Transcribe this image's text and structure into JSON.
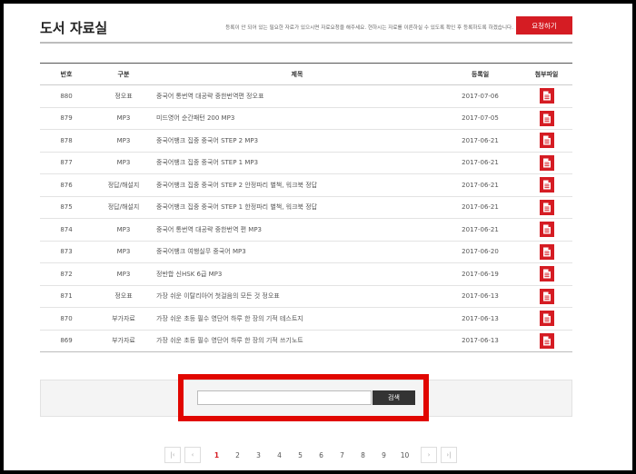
{
  "header": {
    "title": "도서 자료실",
    "note": "등록이 안 되어 있는 필요한 자료가 있으시면 자료요청을 해주세요. 현하시는 자료를 이른하실 수 있도록 확인 후 등록하도록 하겠습니다.",
    "request_label": "요청하기"
  },
  "table": {
    "columns": [
      "번호",
      "구분",
      "제목",
      "등록일",
      "첨부파일"
    ],
    "rows": [
      {
        "no": "880",
        "category": "정오표",
        "title": "중국어 통번역 대공략 중한번역편 정오표",
        "date": "2017-07-06"
      },
      {
        "no": "879",
        "category": "MP3",
        "title": "미드영어 순간패턴 200 MP3",
        "date": "2017-07-05"
      },
      {
        "no": "878",
        "category": "MP3",
        "title": "중국어뱅크 집중 중국어 STEP 2 MP3",
        "date": "2017-06-21"
      },
      {
        "no": "877",
        "category": "MP3",
        "title": "중국어뱅크 집중 중국어 STEP 1 MP3",
        "date": "2017-06-21"
      },
      {
        "no": "876",
        "category": "정답/해설지",
        "title": "중국어뱅크 집중 중국어 STEP 2 안정파리 별책, 워크북 정답",
        "date": "2017-06-21"
      },
      {
        "no": "875",
        "category": "정답/해설지",
        "title": "중국어뱅크 집중 중국어 STEP 1 한정파리 별책, 워크북 정답",
        "date": "2017-06-21"
      },
      {
        "no": "874",
        "category": "MP3",
        "title": "중국어 통번역 대공략 중한번역 편 MP3",
        "date": "2017-06-21"
      },
      {
        "no": "873",
        "category": "MP3",
        "title": "중국어뱅크 여행실무 중국어 MP3",
        "date": "2017-06-20"
      },
      {
        "no": "872",
        "category": "MP3",
        "title": "정반합 신HSK 6급 MP3",
        "date": "2017-06-19"
      },
      {
        "no": "871",
        "category": "정오표",
        "title": "가장 쉬운 이탈리아어 첫걸음의 모든 것 정오표",
        "date": "2017-06-13"
      },
      {
        "no": "870",
        "category": "부가자료",
        "title": "가장 쉬운 초등 필수 영단어 하루 한 장의 기적 테스트지",
        "date": "2017-06-13"
      },
      {
        "no": "869",
        "category": "부가자료",
        "title": "가장 쉬운 초등 필수 영단어 하루 한 장의 기적 쓰기노트",
        "date": "2017-06-13"
      }
    ]
  },
  "search": {
    "input_value": "",
    "placeholder": "",
    "button_label": "검색"
  },
  "pagination": {
    "first": "|‹",
    "prev": "‹",
    "pages": [
      "1",
      "2",
      "3",
      "4",
      "5",
      "6",
      "7",
      "8",
      "9",
      "10"
    ],
    "current": "1",
    "next": "›",
    "last": "›|"
  },
  "colors": {
    "accent": "#d51c23",
    "highlight": "#e10600"
  },
  "icons": {
    "attachment": "document-icon"
  }
}
